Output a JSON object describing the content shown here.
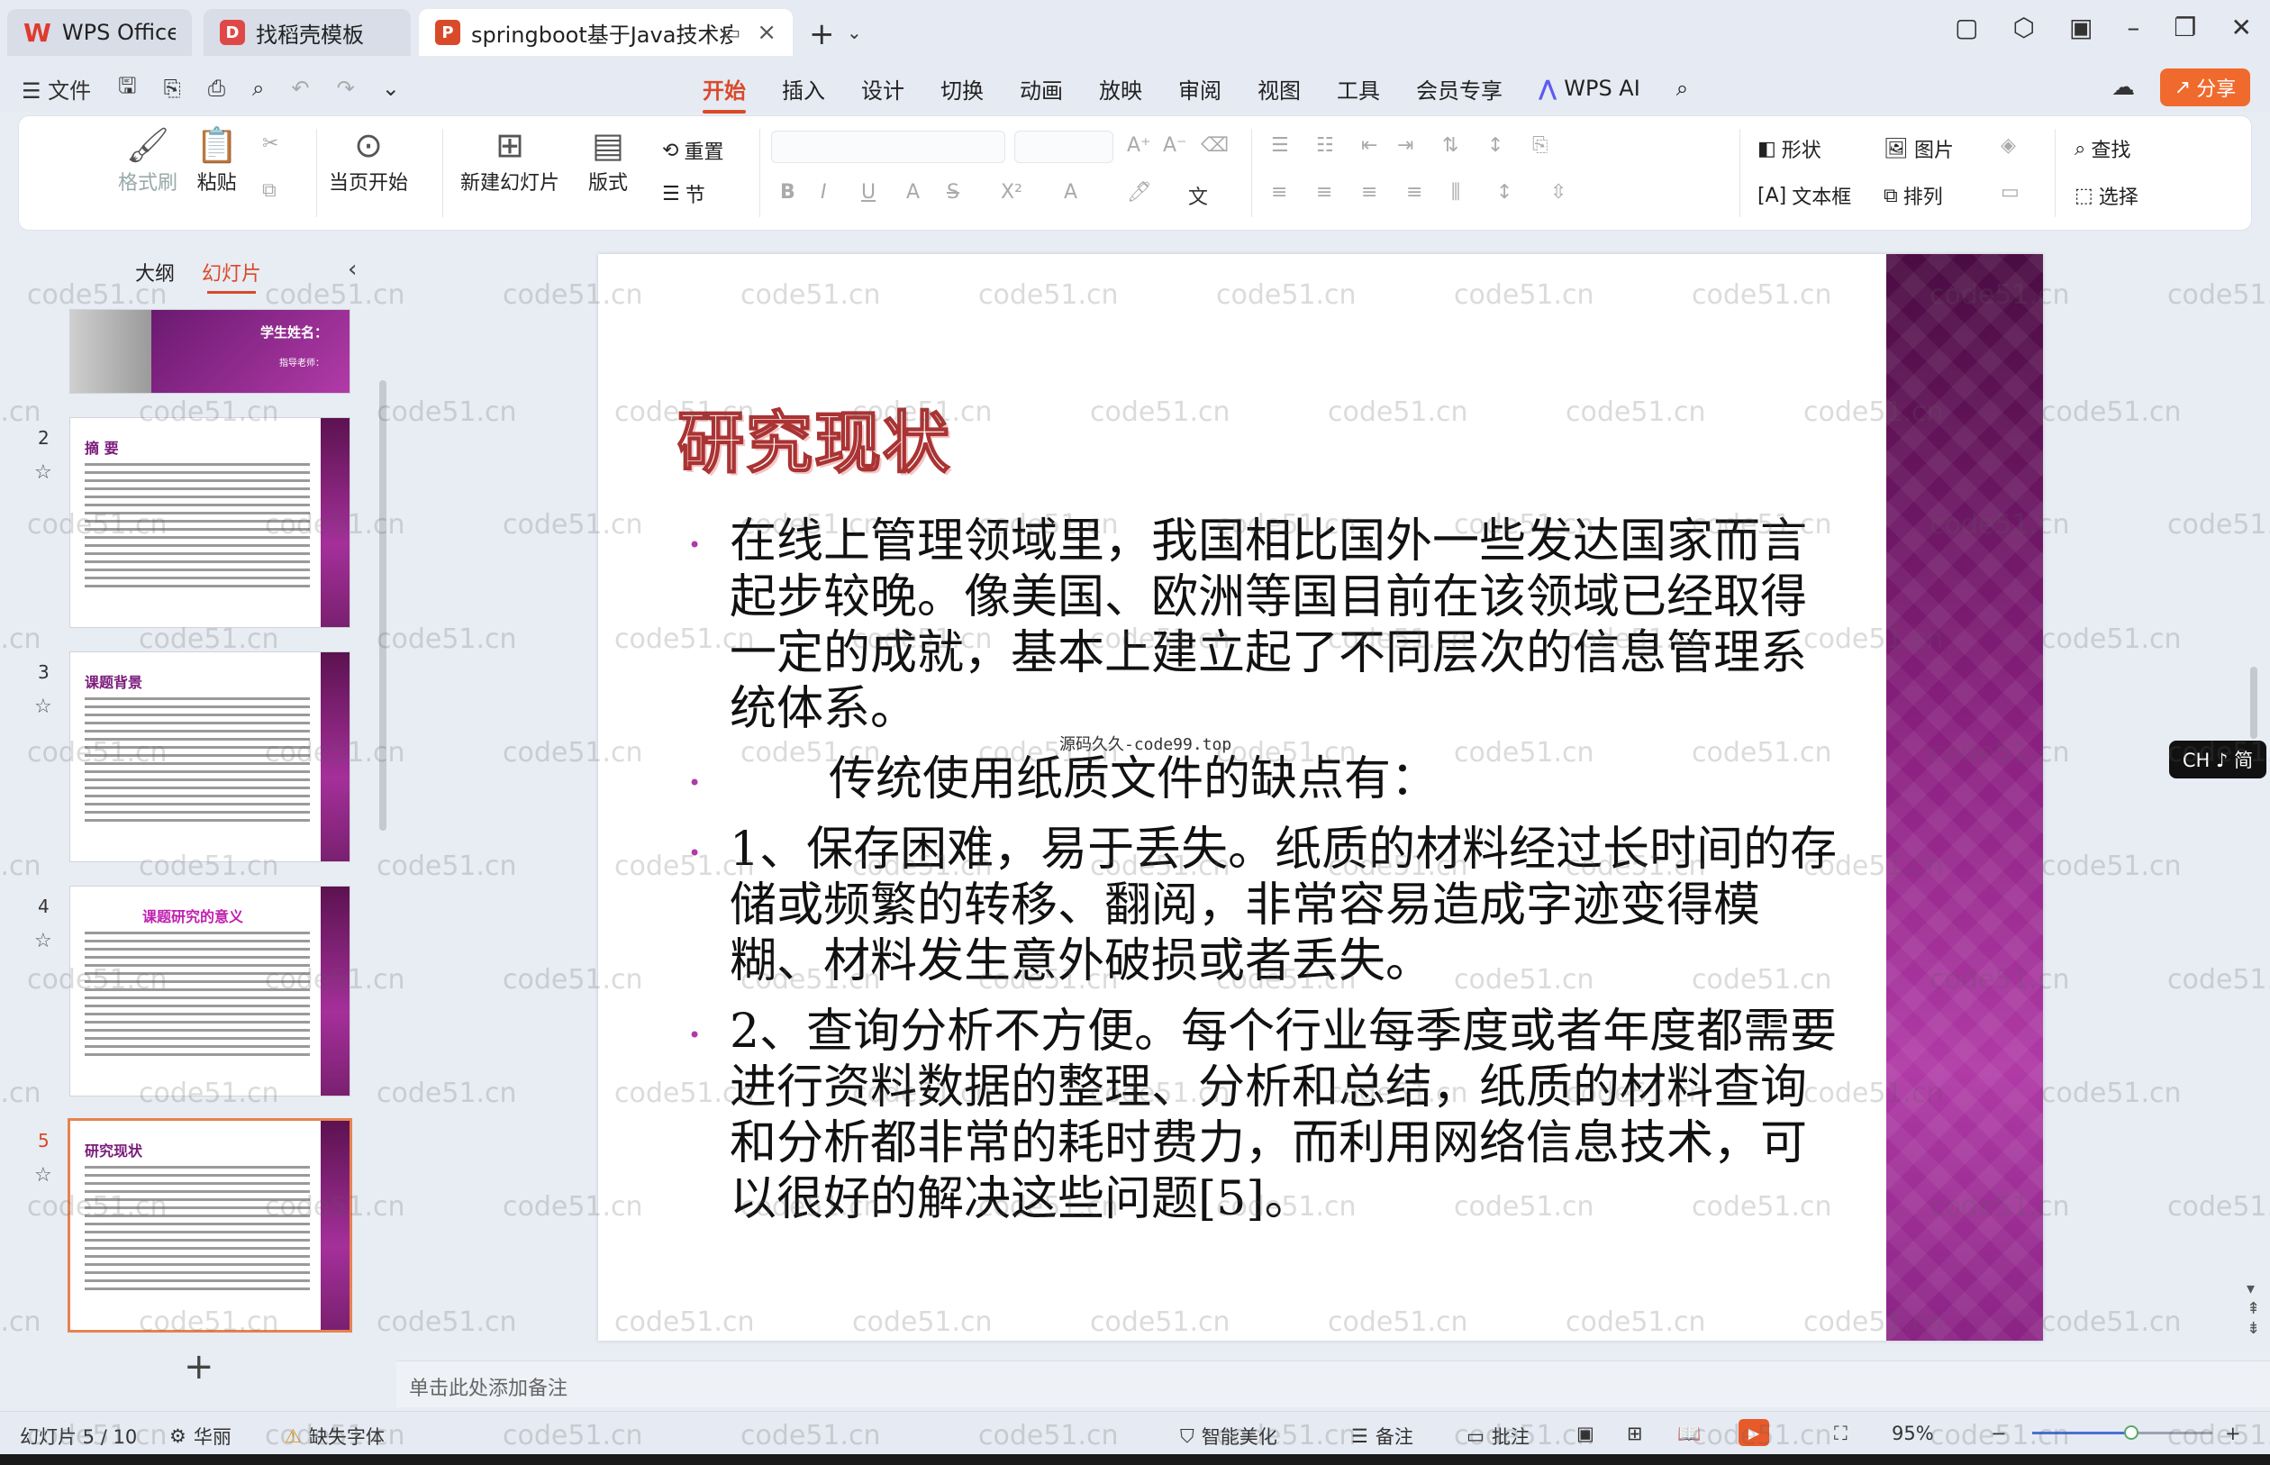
{
  "titlebar": {
    "tabs": [
      {
        "label": "WPS Office",
        "icon": "wps-logo-icon"
      },
      {
        "label": "找稻壳模板",
        "icon": "docer-logo-icon"
      },
      {
        "label": "springboot基于Java技术疫",
        "icon": "ppt-file-icon"
      }
    ]
  },
  "menu": {
    "file": "文件",
    "tabs": [
      "开始",
      "插入",
      "设计",
      "切换",
      "动画",
      "放映",
      "审阅",
      "视图",
      "工具",
      "会员专享"
    ],
    "active_tab": "开始",
    "wps_ai": "WPS AI",
    "share": "分享"
  },
  "ribbon": {
    "format_painter": "格式刷",
    "paste": "粘贴",
    "play_from_current": "当页开始",
    "new_slide": "新建幻灯片",
    "layout": "版式",
    "reset": "重置",
    "section": "节",
    "shape": "形状",
    "picture": "图片",
    "textbox": "文本框",
    "arrange": "排列",
    "find": "查找",
    "select": "选择"
  },
  "left_panel": {
    "tab_outline": "大纲",
    "tab_slides": "幻灯片",
    "thumbs": [
      {
        "num": "",
        "title": "学生姓名：",
        "subtitle": "指导老师："
      },
      {
        "num": "2",
        "title": "摘 要"
      },
      {
        "num": "3",
        "title": "课题背景"
      },
      {
        "num": "4",
        "title": "课题研究的意义"
      },
      {
        "num": "5",
        "title": "研究现状"
      }
    ]
  },
  "slide": {
    "title": "研究现状",
    "paragraphs": [
      "在线上管理领域里，我国相比国外一些发达国家而言起步较晚。像美国、欧洲等国目前在该领域已经取得一定的成就，基本上建立起了不同层次的信息管理系统体系。",
      "传统使用纸质文件的缺点有：",
      "1、保存困难，易于丢失。纸质的材料经过长时间的存储或频繁的转移、翻阅，非常容易造成字迹变得模糊、材料发生意外破损或者丢失。",
      "2、查询分析不方便。每个行业每季度或者年度都需要进行资料数据的整理、分析和总结，纸质的材料查询和分析都非常的耗时费力，而利用网络信息技术，可以很好的解决这些问题[5]。"
    ],
    "inline_watermark": "源码久久-code99.top"
  },
  "notes_placeholder": "单击此处添加备注",
  "ime": "CH ♪ 简",
  "status": {
    "slide_counter": "幻灯片 5 / 10",
    "theme": "华丽",
    "missing_font": "缺失字体",
    "smart_beautify": "智能美化",
    "notes": "备注",
    "comments": "批注",
    "zoom": "95%",
    "zoom_level": 0.55
  },
  "watermark": "code51.cn",
  "colors": {
    "accent": "#d94a2a",
    "slide_bar": "#8a2080"
  }
}
